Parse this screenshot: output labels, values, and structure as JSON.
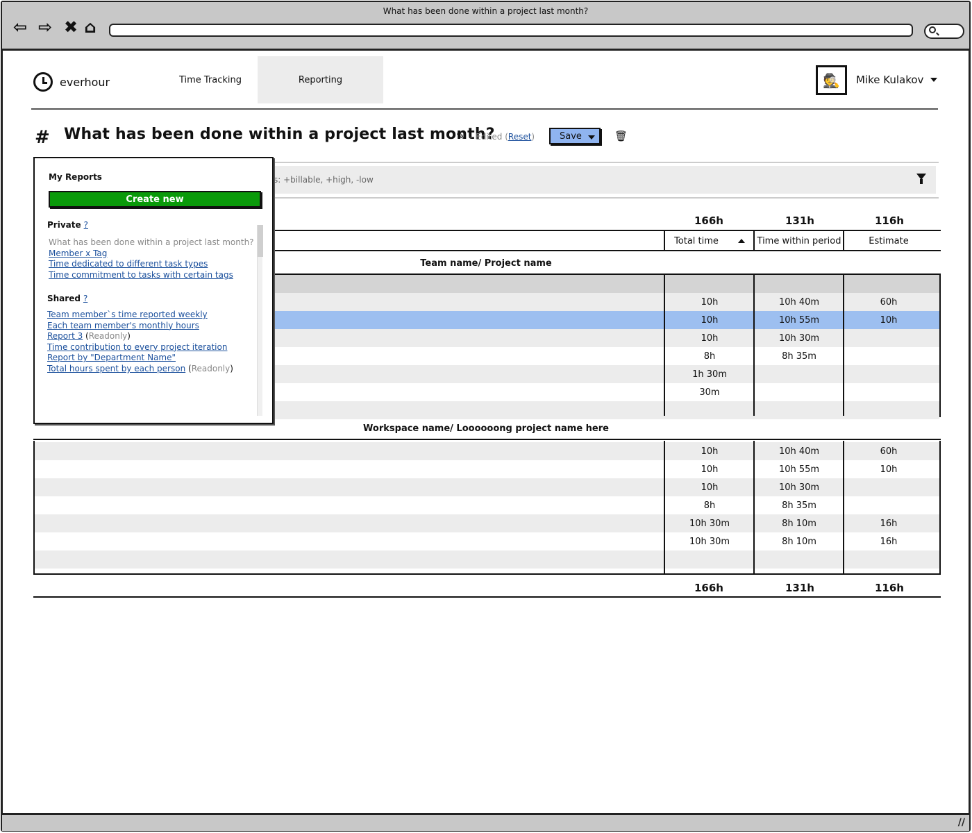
{
  "window": {
    "title": "What has been done within a project last month?"
  },
  "app": {
    "logo_text": "everhour",
    "nav": [
      {
        "label": "Time Tracking"
      },
      {
        "label": "Reporting",
        "active": true
      }
    ],
    "user_name": "Mike Kulakov"
  },
  "report": {
    "title": "What has been done within a project last month?",
    "edited_prefix": "- Edited (",
    "reset_label": "Reset",
    "edited_suffix": ")",
    "save_label": "Save"
  },
  "filter": {
    "text": "s: +billable, +high, -low"
  },
  "columns": {
    "totals_top": [
      "166h",
      "131h",
      "116h"
    ],
    "headers": [
      "Total time",
      "Time within period",
      "Estimate"
    ],
    "totals_bottom": [
      "166h",
      "131h",
      "116h"
    ]
  },
  "groups": [
    {
      "title": "Team name/ Project name",
      "rows": [
        {
          "values": [
            "",
            "",
            ""
          ],
          "style": "dark"
        },
        {
          "values": [
            "10h",
            "10h 40m",
            "60h"
          ],
          "style": "gray"
        },
        {
          "values": [
            "10h",
            "10h 55m",
            "10h"
          ],
          "style": "sel"
        },
        {
          "values": [
            "10h",
            "10h 30m",
            ""
          ],
          "style": "gray"
        },
        {
          "values": [
            "8h",
            "8h 35m",
            ""
          ],
          "style": "white"
        },
        {
          "values": [
            "1h 30m",
            "",
            ""
          ],
          "style": "gray"
        },
        {
          "values": [
            "30m",
            "",
            ""
          ],
          "style": "white"
        },
        {
          "values": [
            "",
            "",
            ""
          ],
          "style": "gray"
        }
      ]
    },
    {
      "title": "Workspace name/ Loooooong project name here",
      "rows": [
        {
          "values": [
            "10h",
            "10h 40m",
            "60h"
          ],
          "style": "gray"
        },
        {
          "values": [
            "10h",
            "10h 55m",
            "10h"
          ],
          "style": "white"
        },
        {
          "values": [
            "10h",
            "10h 30m",
            ""
          ],
          "style": "gray"
        },
        {
          "values": [
            "8h",
            "8h 35m",
            ""
          ],
          "style": "white"
        },
        {
          "values": [
            "10h 30m",
            "8h 10m",
            "16h"
          ],
          "style": "gray"
        },
        {
          "values": [
            "10h 30m",
            "8h 10m",
            "16h"
          ],
          "style": "white"
        },
        {
          "values": [
            "",
            "",
            ""
          ],
          "style": "gray"
        }
      ]
    }
  ],
  "reports_menu": {
    "header": "My Reports",
    "create_label": "Create new",
    "private_label": "Private",
    "help_label": "?",
    "private_items": [
      {
        "label": "What has been done within a project last month?",
        "current": true
      },
      {
        "label": "Member x Tag"
      },
      {
        "label": "Time dedicated to different task types"
      },
      {
        "label": "Time commitment to tasks with certain tags"
      }
    ],
    "shared_label": "Shared",
    "shared_items": [
      {
        "label": "Team member`s time reported weekly"
      },
      {
        "label": "Each team member's monthly hours"
      },
      {
        "label": "Report 3",
        "note": "Readonly"
      },
      {
        "label": "Time contribution to every project iteration"
      },
      {
        "label": "Report by \"Department Name\""
      },
      {
        "label": "Total hours spent by each person",
        "note": "Readonly"
      }
    ]
  }
}
